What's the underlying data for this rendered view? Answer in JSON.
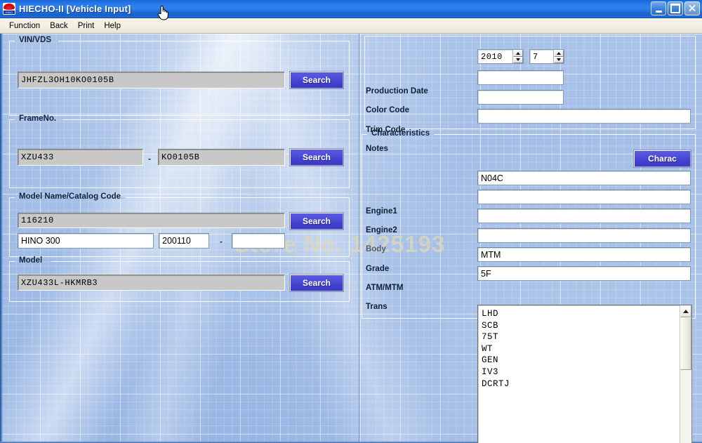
{
  "window": {
    "title": "HIECHO-II [Vehicle Input]",
    "app_icon": "hino-logo-icon",
    "icon_text": "HINO",
    "controls": {
      "minimize": "minimize-button",
      "maximize": "maximize-button",
      "close_label": "✕"
    }
  },
  "menubar": {
    "items": [
      {
        "label": "Function"
      },
      {
        "label": "Back"
      },
      {
        "label": "Print"
      },
      {
        "label": "Help"
      }
    ]
  },
  "watermark": {
    "text": "Store No. 1425193"
  },
  "left_panel": {
    "vin_vds": {
      "legend": "VIN/VDS",
      "value": "JHFZL3OH10KO0105B",
      "search_label": "Search"
    },
    "frame_no": {
      "legend": "FrameNo.",
      "value1": "XZU433",
      "separator": "-",
      "value2": "KO0105B",
      "search_label": "Search"
    },
    "model_name_catalog": {
      "legend": "Model Name/Catalog Code",
      "catalog_code": "116210",
      "search_label": "Search",
      "model_name": "HINO 300",
      "code_from": "200110",
      "separator": "-",
      "code_to": ""
    },
    "model": {
      "legend": "Model",
      "value": "XZU433L-HKMRB3",
      "search_label": "Search"
    }
  },
  "right_panel": {
    "production_date": {
      "label": "Production Date",
      "year": "2010",
      "month": "7"
    },
    "color_code": {
      "label": "Color Code",
      "value": ""
    },
    "trim_code": {
      "label": "Trim Code",
      "value": ""
    },
    "notes": {
      "label": "Notes",
      "value": ""
    },
    "characteristics": {
      "legend": "Characteristics",
      "charac_button": "Charac",
      "fields": [
        {
          "label": "Engine1",
          "value": "N04C"
        },
        {
          "label": "Engine2",
          "value": ""
        },
        {
          "label": "Body",
          "value": ""
        },
        {
          "label": "Grade",
          "value": ""
        },
        {
          "label": "ATM/MTM",
          "value": "MTM"
        },
        {
          "label": "Trans",
          "value": "5F"
        }
      ]
    },
    "option_list": {
      "items": [
        "LHD",
        "SCB",
        "75T",
        "WT",
        "GEN",
        "IV3",
        "DCRTJ"
      ]
    }
  },
  "colors": {
    "titlebar_blue": "#2a7bea",
    "button_blue": "#4242cf",
    "background_blue": "#9fbbe6",
    "readonly_field": "#c8c8c8",
    "menubar": "#f1efe2"
  }
}
